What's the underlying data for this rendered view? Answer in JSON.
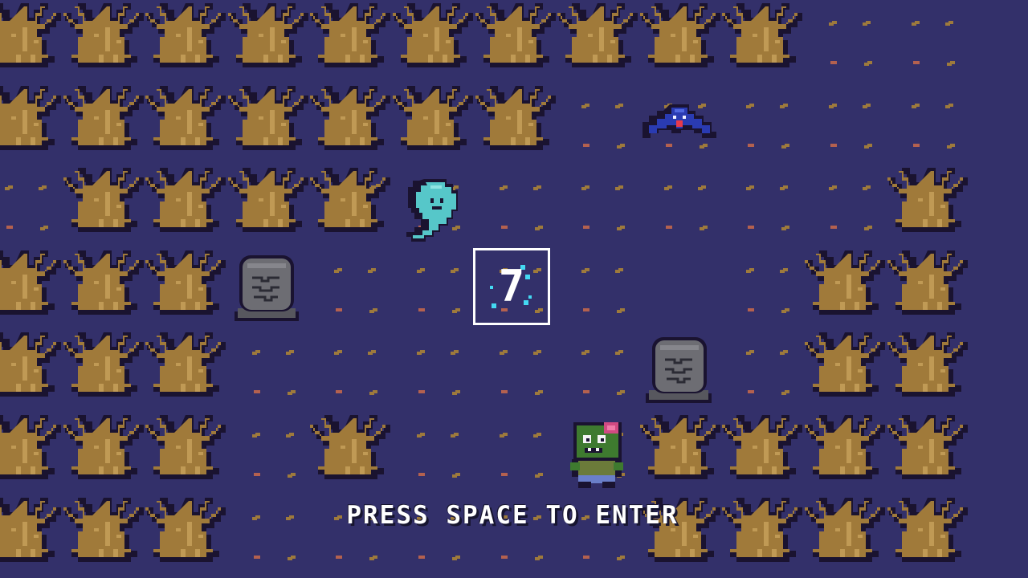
{
  "prompt": {
    "text": "PRESS SPACE TO ENTER"
  },
  "portal": {
    "glyph": "7",
    "glyph_color": "#ffffff",
    "border_color": "#ffffff",
    "sparkle_color": "#44d9f2"
  },
  "palette": {
    "ground": "#33306a",
    "ground_dot_brown": "#9e7a3c",
    "ground_dot_red": "#b4614f",
    "tree_trunk": "#a07a3a",
    "tree_highlight": "#c09a55",
    "tree_outline": "#1a1330",
    "ghost_body": "#56c7c9",
    "bat_body": "#2a3bb2",
    "bat_mouth": "#e83a4a",
    "zombie_skin": "#3e7a2f",
    "zombie_shirt": "#6b7b3a",
    "zombie_pants": "#6a7fc9",
    "grave_stone": "#6d6d73"
  },
  "sprites": {
    "player": "zombie",
    "enemies": [
      "ghost",
      "bat"
    ],
    "props": [
      "gravestone",
      "gravestone",
      "dead-tree"
    ]
  },
  "map": {
    "rows": [
      "##########..",
      "#######.....",
      ".####......#",
      "###.......##",
      "###.......##",
      "###.#...####",
      "###.....####"
    ],
    "ground_speckle_rows": [
      "..........ss",
      ".......sssss",
      "s...sssssss.",
      "...sssss.s..",
      "...sssss.s..",
      "...s.sss....",
      "...sssss...."
    ]
  }
}
